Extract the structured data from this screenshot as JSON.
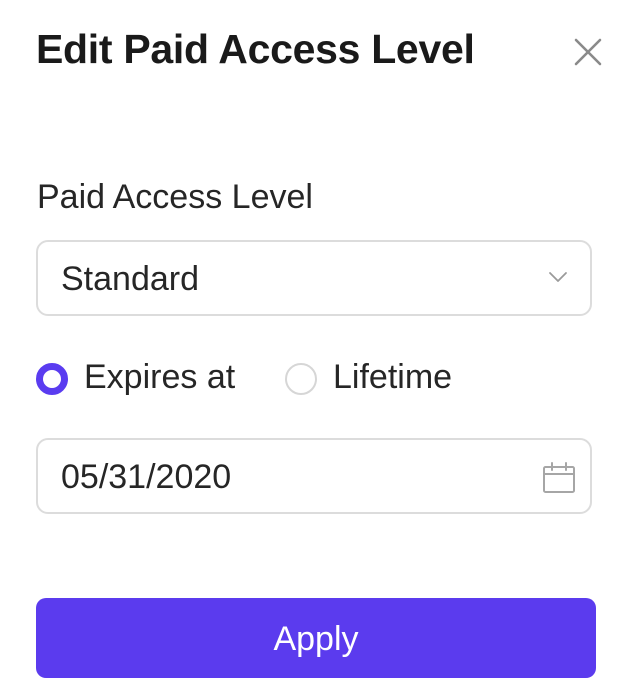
{
  "dialog": {
    "title": "Edit Paid Access Level",
    "close_icon": "close-icon"
  },
  "access_level": {
    "label": "Paid Access Level",
    "selected": "Standard",
    "dropdown_icon": "chevron-down-icon"
  },
  "expiry": {
    "options": [
      {
        "label": "Expires at",
        "checked": true
      },
      {
        "label": "Lifetime",
        "checked": false
      }
    ],
    "date_value": "05/31/2020",
    "date_icon": "calendar-icon"
  },
  "actions": {
    "apply_label": "Apply"
  },
  "colors": {
    "accent": "#5b3bee",
    "border": "#dcdcdc",
    "text": "#262626"
  }
}
